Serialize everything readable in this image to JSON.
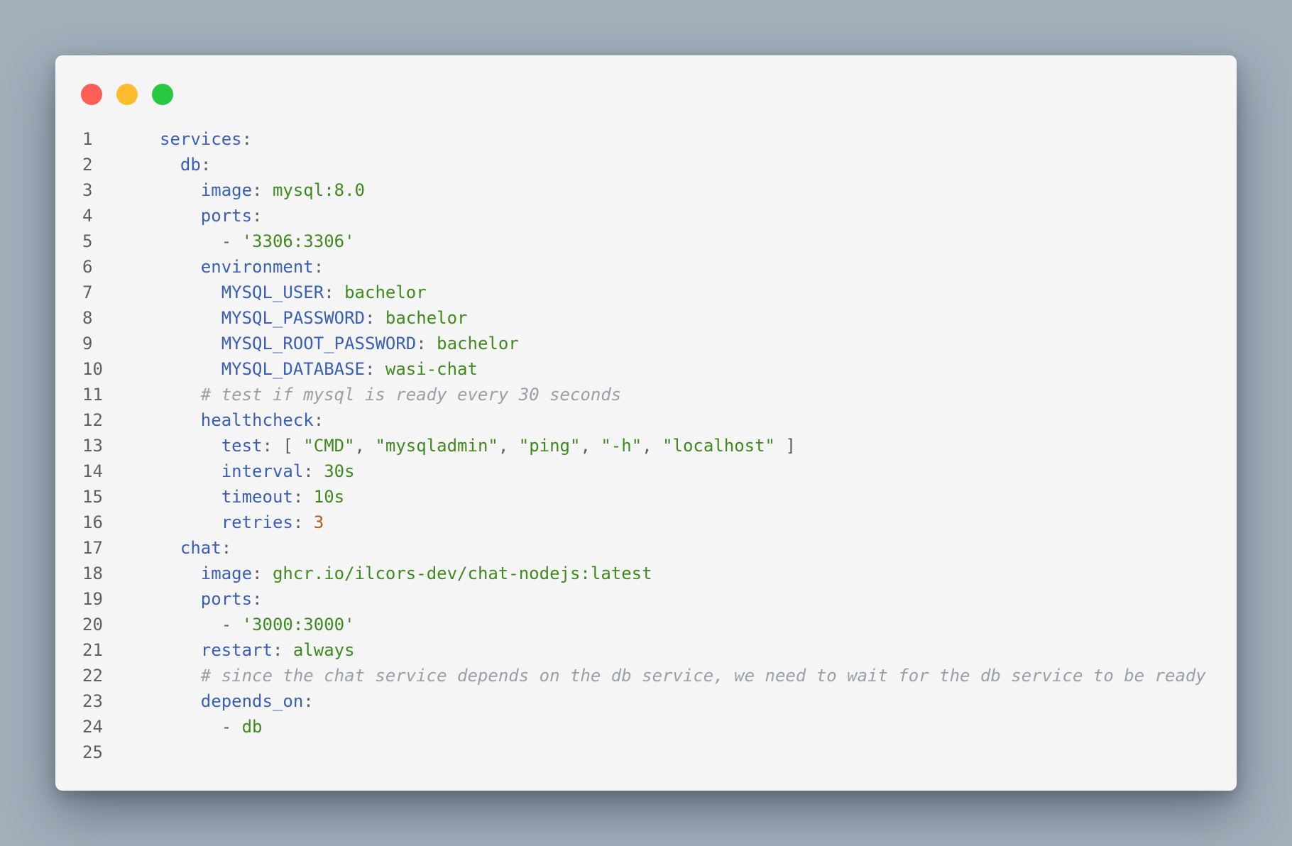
{
  "window": {
    "traffic_lights": [
      {
        "name": "close",
        "color": "#ff5f57"
      },
      {
        "name": "minimize",
        "color": "#febc2e"
      },
      {
        "name": "zoom",
        "color": "#28c840"
      }
    ]
  },
  "code": {
    "language": "yaml",
    "lines": [
      {
        "n": "1",
        "tokens": [
          {
            "t": "k",
            "v": "services"
          },
          {
            "t": "p",
            "v": ":"
          }
        ]
      },
      {
        "n": "2",
        "tokens": [
          {
            "t": "p",
            "v": "  "
          },
          {
            "t": "k",
            "v": "db"
          },
          {
            "t": "p",
            "v": ":"
          }
        ]
      },
      {
        "n": "3",
        "tokens": [
          {
            "t": "p",
            "v": "    "
          },
          {
            "t": "k",
            "v": "image"
          },
          {
            "t": "p",
            "v": ": "
          },
          {
            "t": "v",
            "v": "mysql:8.0"
          }
        ]
      },
      {
        "n": "4",
        "tokens": [
          {
            "t": "p",
            "v": "    "
          },
          {
            "t": "k",
            "v": "ports"
          },
          {
            "t": "p",
            "v": ":"
          }
        ]
      },
      {
        "n": "5",
        "tokens": [
          {
            "t": "p",
            "v": "      - "
          },
          {
            "t": "v",
            "v": "'3306:3306'"
          }
        ]
      },
      {
        "n": "6",
        "tokens": [
          {
            "t": "p",
            "v": "    "
          },
          {
            "t": "k",
            "v": "environment"
          },
          {
            "t": "p",
            "v": ":"
          }
        ]
      },
      {
        "n": "7",
        "tokens": [
          {
            "t": "p",
            "v": "      "
          },
          {
            "t": "k",
            "v": "MYSQL_USER"
          },
          {
            "t": "p",
            "v": ": "
          },
          {
            "t": "v",
            "v": "bachelor"
          }
        ]
      },
      {
        "n": "8",
        "tokens": [
          {
            "t": "p",
            "v": "      "
          },
          {
            "t": "k",
            "v": "MYSQL_PASSWORD"
          },
          {
            "t": "p",
            "v": ": "
          },
          {
            "t": "v",
            "v": "bachelor"
          }
        ]
      },
      {
        "n": "9",
        "tokens": [
          {
            "t": "p",
            "v": "      "
          },
          {
            "t": "k",
            "v": "MYSQL_ROOT_PASSWORD"
          },
          {
            "t": "p",
            "v": ": "
          },
          {
            "t": "v",
            "v": "bachelor"
          }
        ]
      },
      {
        "n": "10",
        "tokens": [
          {
            "t": "p",
            "v": "      "
          },
          {
            "t": "k",
            "v": "MYSQL_DATABASE"
          },
          {
            "t": "p",
            "v": ": "
          },
          {
            "t": "v",
            "v": "wasi-chat"
          }
        ]
      },
      {
        "n": "11",
        "tokens": [
          {
            "t": "p",
            "v": "    "
          },
          {
            "t": "c",
            "v": "# test if mysql is ready every 30 seconds"
          }
        ]
      },
      {
        "n": "12",
        "tokens": [
          {
            "t": "p",
            "v": "    "
          },
          {
            "t": "k",
            "v": "healthcheck"
          },
          {
            "t": "p",
            "v": ":"
          }
        ]
      },
      {
        "n": "13",
        "tokens": [
          {
            "t": "p",
            "v": "      "
          },
          {
            "t": "k",
            "v": "test"
          },
          {
            "t": "p",
            "v": ": [ "
          },
          {
            "t": "v",
            "v": "\"CMD\""
          },
          {
            "t": "p",
            "v": ", "
          },
          {
            "t": "v",
            "v": "\"mysqladmin\""
          },
          {
            "t": "p",
            "v": ", "
          },
          {
            "t": "v",
            "v": "\"ping\""
          },
          {
            "t": "p",
            "v": ", "
          },
          {
            "t": "v",
            "v": "\"-h\""
          },
          {
            "t": "p",
            "v": ", "
          },
          {
            "t": "v",
            "v": "\"localhost\""
          },
          {
            "t": "p",
            "v": " ]"
          }
        ]
      },
      {
        "n": "14",
        "tokens": [
          {
            "t": "p",
            "v": "      "
          },
          {
            "t": "k",
            "v": "interval"
          },
          {
            "t": "p",
            "v": ": "
          },
          {
            "t": "v",
            "v": "30s"
          }
        ]
      },
      {
        "n": "15",
        "tokens": [
          {
            "t": "p",
            "v": "      "
          },
          {
            "t": "k",
            "v": "timeout"
          },
          {
            "t": "p",
            "v": ": "
          },
          {
            "t": "v",
            "v": "10s"
          }
        ]
      },
      {
        "n": "16",
        "tokens": [
          {
            "t": "p",
            "v": "      "
          },
          {
            "t": "k",
            "v": "retries"
          },
          {
            "t": "p",
            "v": ": "
          },
          {
            "t": "n",
            "v": "3"
          }
        ]
      },
      {
        "n": "17",
        "tokens": [
          {
            "t": "p",
            "v": "  "
          },
          {
            "t": "k",
            "v": "chat"
          },
          {
            "t": "p",
            "v": ":"
          }
        ]
      },
      {
        "n": "18",
        "tokens": [
          {
            "t": "p",
            "v": "    "
          },
          {
            "t": "k",
            "v": "image"
          },
          {
            "t": "p",
            "v": ": "
          },
          {
            "t": "v",
            "v": "ghcr.io/ilcors-dev/chat-nodejs:latest"
          }
        ]
      },
      {
        "n": "19",
        "tokens": [
          {
            "t": "p",
            "v": "    "
          },
          {
            "t": "k",
            "v": "ports"
          },
          {
            "t": "p",
            "v": ":"
          }
        ]
      },
      {
        "n": "20",
        "tokens": [
          {
            "t": "p",
            "v": "      - "
          },
          {
            "t": "v",
            "v": "'3000:3000'"
          }
        ]
      },
      {
        "n": "21",
        "tokens": [
          {
            "t": "p",
            "v": "    "
          },
          {
            "t": "k",
            "v": "restart"
          },
          {
            "t": "p",
            "v": ": "
          },
          {
            "t": "v",
            "v": "always"
          }
        ]
      },
      {
        "n": "22",
        "tokens": [
          {
            "t": "p",
            "v": "    "
          },
          {
            "t": "c",
            "v": "# since the chat service depends on the db service, we need to wait for the db service to be ready"
          }
        ]
      },
      {
        "n": "23",
        "tokens": [
          {
            "t": "p",
            "v": "    "
          },
          {
            "t": "k",
            "v": "depends_on"
          },
          {
            "t": "p",
            "v": ":"
          }
        ]
      },
      {
        "n": "24",
        "tokens": [
          {
            "t": "p",
            "v": "      - "
          },
          {
            "t": "v",
            "v": "db"
          }
        ]
      },
      {
        "n": "25",
        "tokens": []
      }
    ]
  }
}
